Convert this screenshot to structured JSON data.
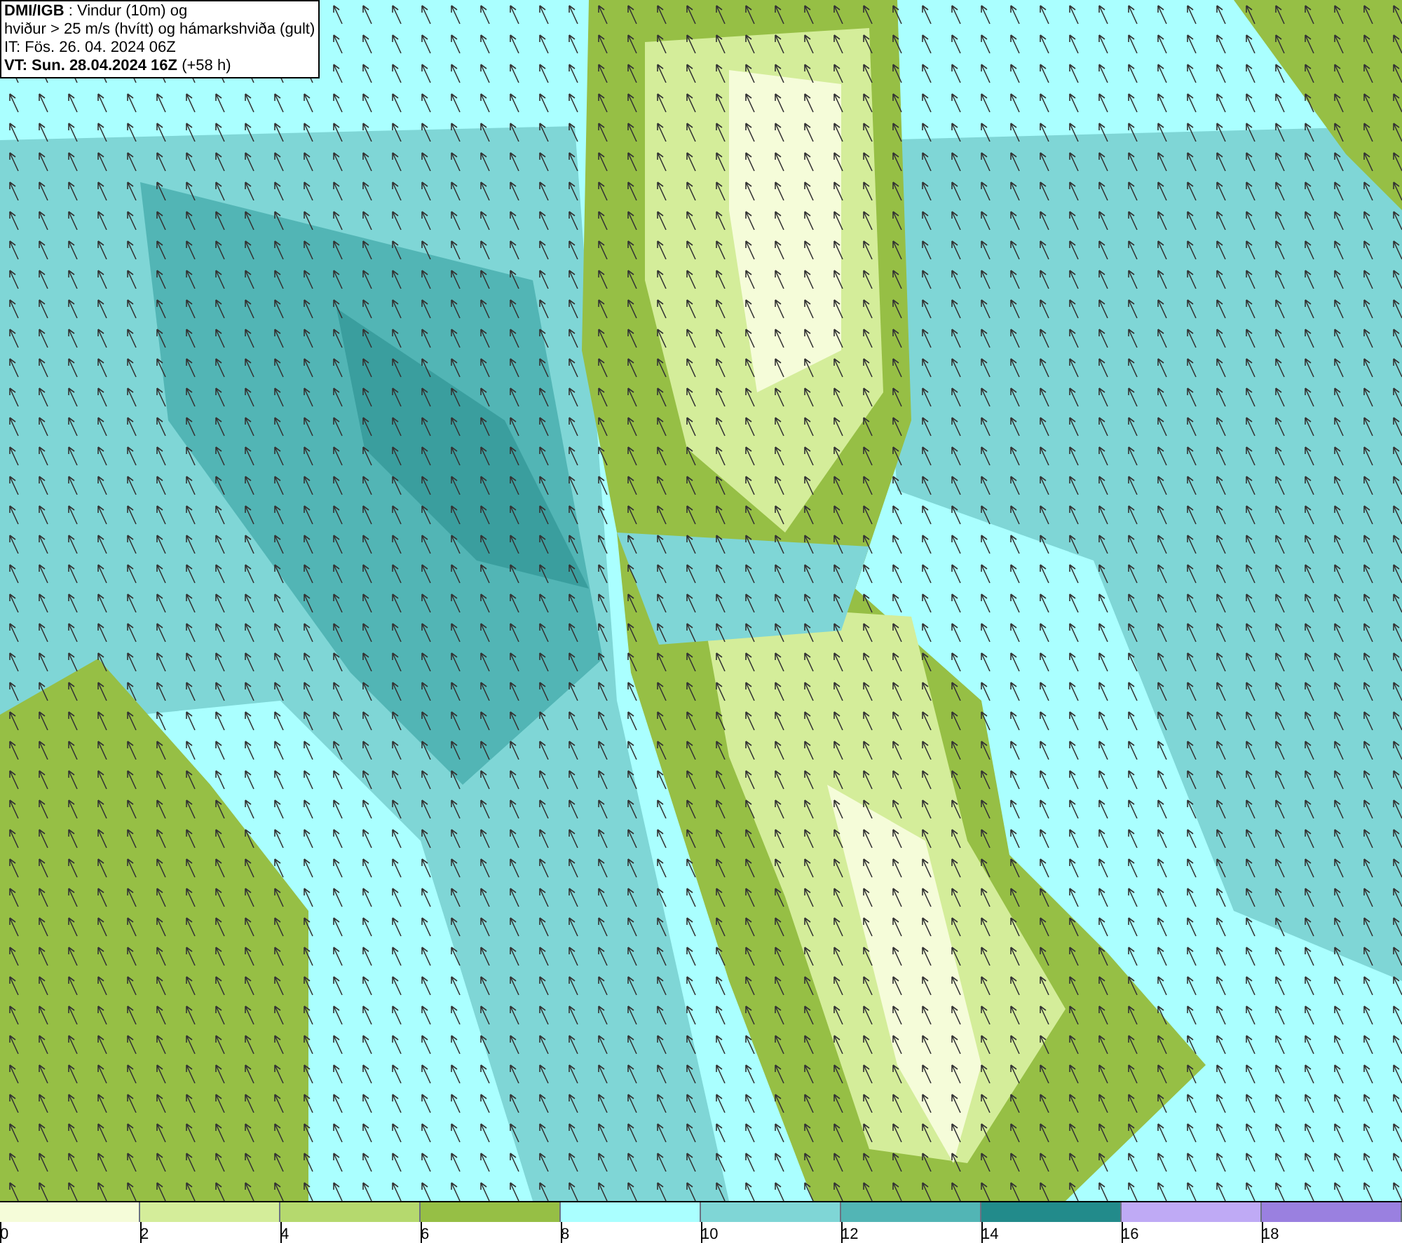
{
  "header": {
    "lines": [
      "**DMI/IGB** : Vindur (10m) og",
      "hviður > 25 m/s (hvítt) og hámarkshviða (gult)",
      "IT: Fös. 26. 04. 2024 06Z",
      "**VT: Sun. 28.04.2024 16Z** (+58 h)"
    ]
  },
  "legend": [
    {
      "label": "0",
      "color": "#f5fcd9"
    },
    {
      "label": "2",
      "color": "#d4ed9a"
    },
    {
      "label": "4",
      "color": "#b5d96e"
    },
    {
      "label": "6",
      "color": "#96bf45"
    },
    {
      "label": "8",
      "color": "#aaffff"
    },
    {
      "label": "10",
      "color": "#7fd6d6"
    },
    {
      "label": "12",
      "color": "#52b5b5"
    },
    {
      "label": "14",
      "color": "#228b8b"
    },
    {
      "label": "16",
      "color": "#bfaaf5"
    },
    {
      "label": "18",
      "color": "#9a80e0"
    }
  ]
}
